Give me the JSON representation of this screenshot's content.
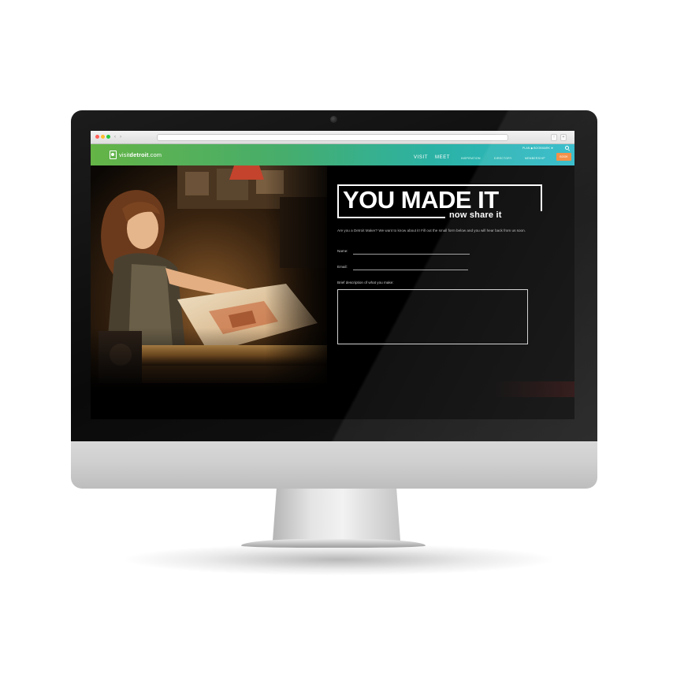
{
  "browser": {
    "nav_back": "‹",
    "nav_forward": "›"
  },
  "site": {
    "logo_prefix": "visit",
    "logo_name": "detroit",
    "logo_suffix": ".com",
    "util_links": "PLAN   ◆ BOOKMARK ★",
    "nav_main": [
      "VISIT",
      "MEET"
    ],
    "nav_sub": [
      "INSPIRATION",
      "DIRECTORY",
      "MEMBERSHIP"
    ],
    "book_label": "BOOK",
    "brand_colors": {
      "gradient_start": "#64b446",
      "gradient_end": "#2ab8c8",
      "book_button": "#f2873a"
    }
  },
  "hero": {
    "headline": "YOU MADE IT",
    "subhead": "now share it",
    "intro": "Are you a Detroit Maker? We want to know about it! Fill out the small form below and you will hear back from us soon."
  },
  "form": {
    "name_label": "Name:",
    "email_label": "Email:",
    "description_label": "Brief description of what you make:"
  },
  "icons": {
    "search": "search-icon",
    "logo": "logo-icon"
  }
}
